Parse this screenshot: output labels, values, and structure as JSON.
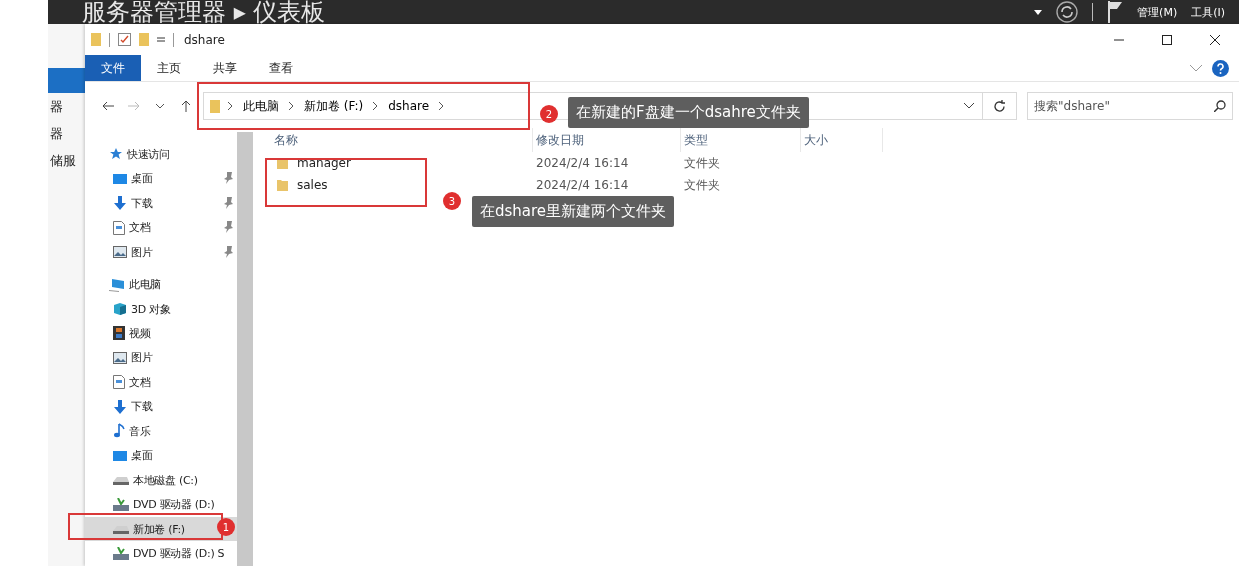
{
  "server_manager": {
    "title": "服务器管理器 ▸ 仪表板",
    "menus": [
      "管理(M)",
      "工具(I)"
    ],
    "sidebar": [
      "器",
      "器",
      "储服"
    ]
  },
  "window": {
    "title": "dshare"
  },
  "ribbon_tabs": [
    {
      "label": "文件",
      "selected": true
    },
    {
      "label": "主页",
      "selected": false
    },
    {
      "label": "共享",
      "selected": false
    },
    {
      "label": "查看",
      "selected": false
    }
  ],
  "address": {
    "crumbs": [
      "此电脑",
      "新加卷 (F:)",
      "dshare"
    ]
  },
  "search": {
    "placeholder": "搜索\"dshare\""
  },
  "nav": [
    {
      "label": "快速访问",
      "kind": "star",
      "pinned": false,
      "selected": false,
      "children": [
        {
          "label": "桌面",
          "kind": "desktop",
          "pinned": true,
          "selected": false
        },
        {
          "label": "下载",
          "kind": "download",
          "pinned": true,
          "selected": false
        },
        {
          "label": "文档",
          "kind": "document",
          "pinned": true,
          "selected": false
        },
        {
          "label": "图片",
          "kind": "image",
          "pinned": true,
          "selected": false
        }
      ]
    },
    {
      "label": "此电脑",
      "kind": "computer",
      "pinned": false,
      "selected": false,
      "children": [
        {
          "label": "3D 对象",
          "kind": "cube",
          "pinned": false,
          "selected": false
        },
        {
          "label": "视频",
          "kind": "film",
          "pinned": false,
          "selected": false
        },
        {
          "label": "图片",
          "kind": "image",
          "pinned": false,
          "selected": false
        },
        {
          "label": "文档",
          "kind": "document",
          "pinned": false,
          "selected": false
        },
        {
          "label": "下载",
          "kind": "download",
          "pinned": false,
          "selected": false
        },
        {
          "label": "音乐",
          "kind": "music",
          "pinned": false,
          "selected": false
        },
        {
          "label": "桌面",
          "kind": "desktop",
          "pinned": false,
          "selected": false
        },
        {
          "label": "本地磁盘 (C:)",
          "kind": "drive",
          "pinned": false,
          "selected": false
        },
        {
          "label": "DVD 驱动器 (D:)",
          "kind": "dvd",
          "pinned": false,
          "selected": false
        },
        {
          "label": "新加卷 (F:)",
          "kind": "drive",
          "pinned": false,
          "selected": true
        },
        {
          "label": "DVD 驱动器 (D:) S",
          "kind": "dvd",
          "pinned": false,
          "selected": false
        }
      ]
    }
  ],
  "table": {
    "columns": [
      "名称",
      "修改日期",
      "类型",
      "大小"
    ],
    "rows": [
      {
        "name": "manager",
        "modified": "2024/2/4 16:14",
        "type": "文件夹"
      },
      {
        "name": "sales",
        "modified": "2024/2/4 16:14",
        "type": "文件夹"
      }
    ]
  },
  "annotations": [
    {
      "number": "1"
    },
    {
      "number": "2",
      "text": "在新建的F盘建一个dsahre文件夹"
    },
    {
      "number": "3",
      "text": "在dshare里新建两个文件夹"
    }
  ]
}
